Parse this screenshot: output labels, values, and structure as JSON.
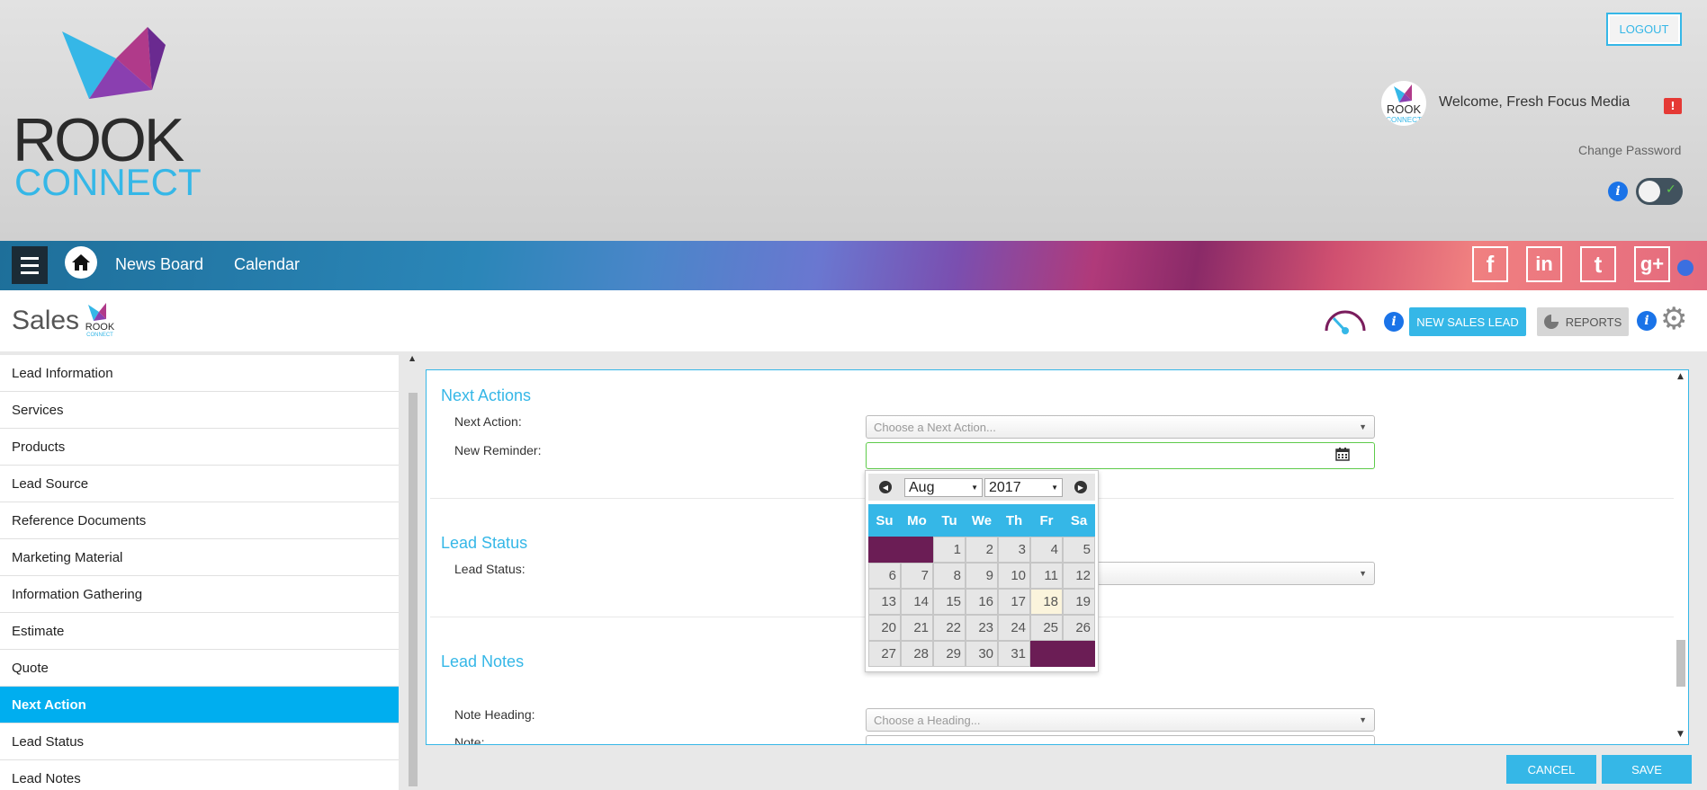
{
  "header": {
    "logo_text_top": "ROOK",
    "logo_text_bottom": "CONNECT",
    "logout_label": "LOGOUT",
    "welcome_text": "Welcome, Fresh Focus Media",
    "alert_badge": "!",
    "change_password_label": "Change Password",
    "accent_color": "#35b7e7"
  },
  "nav": {
    "links": [
      "News Board",
      "Calendar"
    ],
    "social": [
      "facebook-icon",
      "linkedin-icon",
      "twitter-icon",
      "google-plus-icon"
    ],
    "social_glyphs": [
      "f",
      "in",
      "t",
      "g+"
    ]
  },
  "page": {
    "title": "Sales",
    "new_lead_label": "NEW SALES LEAD",
    "reports_label": "REPORTS"
  },
  "sidebar": {
    "items": [
      {
        "label": "Lead Information"
      },
      {
        "label": "Services"
      },
      {
        "label": "Products"
      },
      {
        "label": "Lead Source"
      },
      {
        "label": "Reference Documents"
      },
      {
        "label": "Marketing Material"
      },
      {
        "label": "Information Gathering"
      },
      {
        "label": "Estimate"
      },
      {
        "label": "Quote"
      },
      {
        "label": "Next Action",
        "active": true
      },
      {
        "label": "Lead Status"
      },
      {
        "label": "Lead Notes"
      }
    ]
  },
  "main": {
    "next_actions": {
      "title": "Next Actions",
      "next_action_label": "Next Action:",
      "next_action_placeholder": "Choose a Next Action...",
      "reminder_label": "New Reminder:",
      "reminder_value": ""
    },
    "lead_status": {
      "title": "Lead Status",
      "label": "Lead Status:",
      "value": ""
    },
    "lead_notes": {
      "title": "Lead Notes",
      "heading_label": "Note Heading:",
      "heading_placeholder": "Choose a Heading...",
      "note_label": "Note:"
    }
  },
  "datepicker": {
    "month": "Aug",
    "year": "2017",
    "day_names": [
      "Su",
      "Mo",
      "Tu",
      "We",
      "Th",
      "Fr",
      "Sa"
    ],
    "weeks": [
      [
        "",
        "",
        "1",
        "2",
        "3",
        "4",
        "5"
      ],
      [
        "6",
        "7",
        "8",
        "9",
        "10",
        "11",
        "12"
      ],
      [
        "13",
        "14",
        "15",
        "16",
        "17",
        "18",
        "19"
      ],
      [
        "20",
        "21",
        "22",
        "23",
        "24",
        "25",
        "26"
      ],
      [
        "27",
        "28",
        "29",
        "30",
        "31",
        "",
        ""
      ]
    ],
    "today": "18",
    "empty_cell_color": "#6b1d55"
  },
  "footer": {
    "cancel_label": "CANCEL",
    "save_label": "SAVE"
  }
}
